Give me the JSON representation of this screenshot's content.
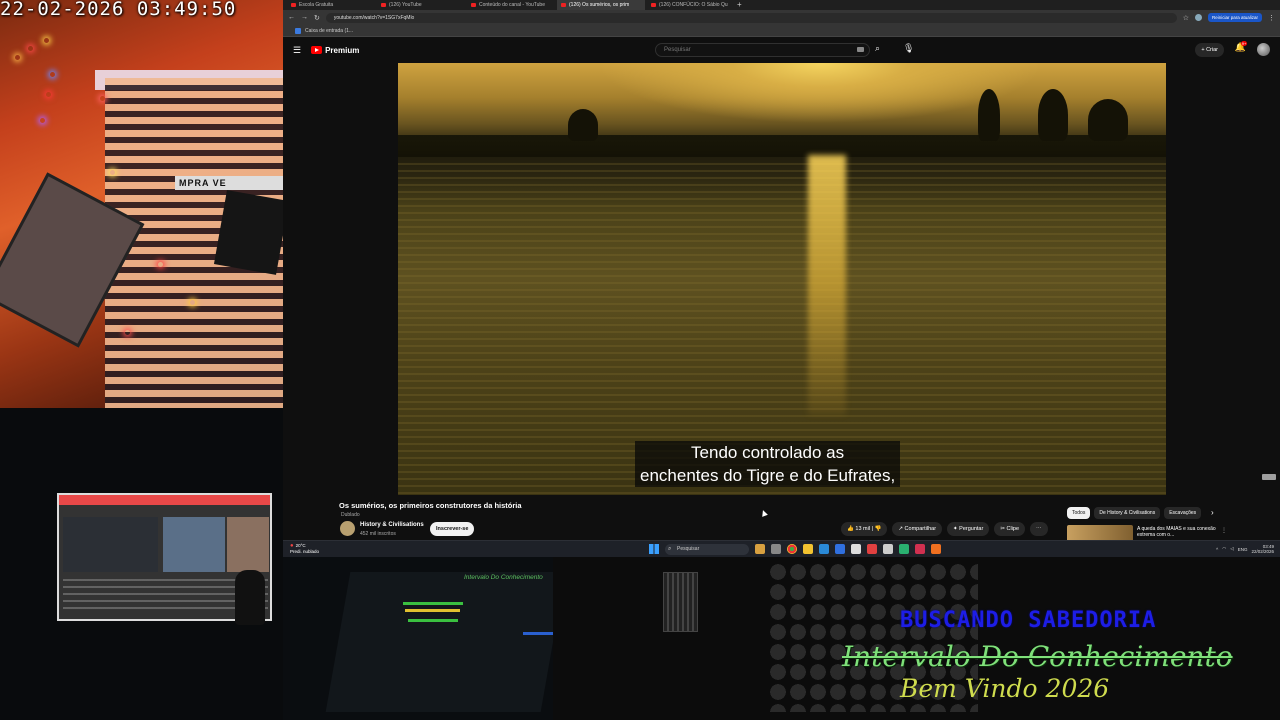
{
  "overlay": {
    "datetime": "22-02-2026 03:49:50",
    "line1": "BUSCANDO SABEDORIA",
    "line2": "Intervalo Do Conhecimento",
    "line3": "Bem Vindo 2026"
  },
  "webcam": {
    "sign_text": "MPRA VE",
    "desk_monitor_text": "Intervalo Do Conhecimento"
  },
  "browser": {
    "tabs": [
      {
        "label": "Escola Gratuita",
        "active": false
      },
      {
        "label": "(126) YouTube",
        "active": false
      },
      {
        "label": "Conteúdo do canal - YouTube",
        "active": false
      },
      {
        "label": "(126) Os sumérios, os prim",
        "active": true
      },
      {
        "label": "(126) CONFÚCIO: O Sábio Qu",
        "active": false
      }
    ],
    "new_tab": "+",
    "url": "youtube.com/watch?v=1SG7xFqMlo",
    "restart_label": "Reiniciar para atualizar",
    "bookmark": "Caixa de entrada (1..."
  },
  "youtube": {
    "logo": "Premium",
    "search_placeholder": "Pesquisar",
    "create_label": "Criar",
    "notif_count": "9+",
    "caption_line1": "Tendo controlado as",
    "caption_line2": "enchentes do Tigre e do Eufrates,",
    "video_title": "Os sumérios, os primeiros construtores da história",
    "dubbed": "Dublado",
    "channel_name": "History & Civilisations",
    "subscribers": "452 mil inscritos",
    "subscribe_label": "Inscrever-se",
    "likes": "13 mil",
    "share_label": "Compartilhar",
    "ask_label": "Perguntar",
    "clip_label": "Clipe",
    "chips": [
      "Todos",
      "De History & Civilisations",
      "Escavações"
    ],
    "rec_title": "A queda dos MAIAS e sua conexão extrema com o..."
  },
  "taskbar": {
    "temp": "20°C",
    "weather": "Predi. nublado",
    "search_label": "Pesquisar",
    "lang": "ENG",
    "time": "03:49",
    "date": "22/02/2026"
  }
}
